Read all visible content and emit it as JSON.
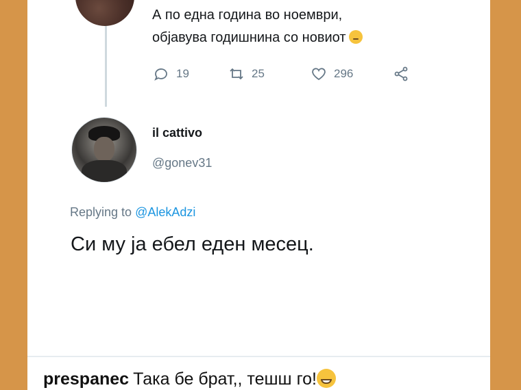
{
  "parent_tweet": {
    "text_lines": [
      "А по една година во ноември,",
      "објавува годишнина со новиот"
    ],
    "emoji": "thinking-face-emoji",
    "replies": "19",
    "retweets": "25",
    "likes": "296"
  },
  "reply_tweet": {
    "display_name": "il cattivo",
    "handle": "@gonev31",
    "replying_to_label": "Replying to",
    "replying_to_mention": "@AlekAdzi",
    "text": "Си му ја ебел еден месец."
  },
  "caption": {
    "username": "prespanec",
    "text": "Така бе брат,, тешш го!",
    "emoji": "grinning-sweat-emoji"
  },
  "colors": {
    "background": "#d69549",
    "card": "#ffffff",
    "muted_text": "#657786",
    "link": "#1b95e0",
    "thread_line": "#cfd9de"
  }
}
